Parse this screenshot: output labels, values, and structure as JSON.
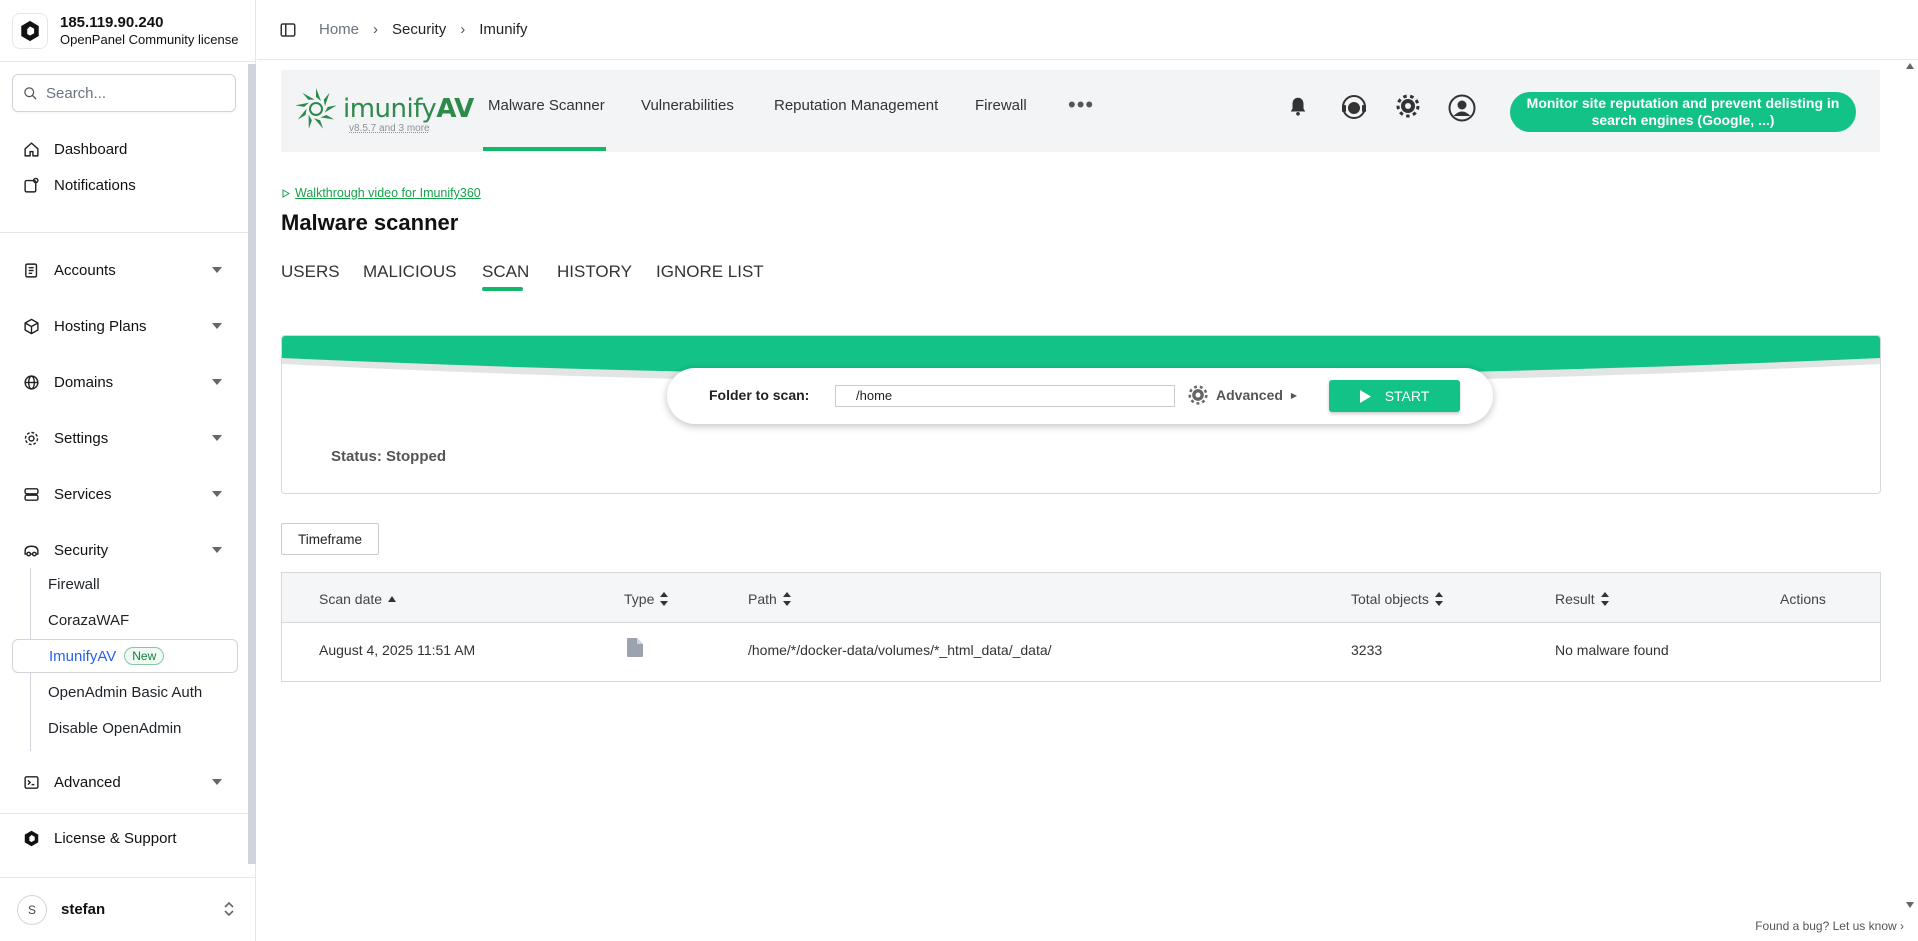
{
  "sidebar": {
    "host": "185.119.90.240",
    "license": "OpenPanel Community license",
    "search_placeholder": "Search...",
    "items": [
      {
        "label": "Dashboard",
        "icon": "home-icon"
      },
      {
        "label": "Notifications",
        "icon": "notification-icon"
      },
      {
        "label": "Accounts",
        "icon": "accounts-icon"
      },
      {
        "label": "Hosting Plans",
        "icon": "package-icon"
      },
      {
        "label": "Domains",
        "icon": "globe-icon"
      },
      {
        "label": "Settings",
        "icon": "gear-icon"
      },
      {
        "label": "Services",
        "icon": "server-icon"
      },
      {
        "label": "Security",
        "icon": "security-icon"
      },
      {
        "label": "Advanced",
        "icon": "terminal-icon"
      },
      {
        "label": "License & Support",
        "icon": "openpanel-logo-icon"
      }
    ],
    "security_sub": [
      {
        "label": "Firewall"
      },
      {
        "label": "CorazaWAF"
      },
      {
        "label": "ImunifyAV",
        "badge": "New"
      },
      {
        "label": "OpenAdmin Basic Auth"
      },
      {
        "label": "Disable OpenAdmin"
      }
    ],
    "user_initial": "S",
    "user_name": "stefan"
  },
  "breadcrumb": [
    "Home",
    "Security",
    "Imunify"
  ],
  "imunify": {
    "logo_light": "imunify",
    "logo_bold": "AV",
    "version": "v8.5.7 and 3 more",
    "tabs": [
      "Malware Scanner",
      "Vulnerabilities",
      "Reputation Management",
      "Firewall"
    ],
    "more": "•••",
    "cta": "Monitor site reputation and prevent delisting in search engines (Google, ...)"
  },
  "page": {
    "walkthrough": "Walkthrough video for Imunify360",
    "title": "Malware scanner",
    "tabs": [
      "USERS",
      "MALICIOUS",
      "SCAN",
      "HISTORY",
      "IGNORE LIST"
    ],
    "active_tab": "SCAN"
  },
  "scan": {
    "folder_label": "Folder to scan:",
    "folder_value": "/home",
    "advanced_label": "Advanced",
    "start_label": "START",
    "status": "Status: Stopped"
  },
  "timeframe_label": "Timeframe",
  "table": {
    "columns": [
      "Scan date",
      "Type",
      "Path",
      "Total objects",
      "Result",
      "Actions"
    ],
    "rows": [
      {
        "date": "August 4, 2025 11:51 AM",
        "type_icon": "file-icon",
        "path": "/home/*/docker-data/volumes/*_html_data/_data/",
        "total": "3233",
        "result": "No malware found"
      }
    ]
  },
  "found_bug": "Found a bug? Let us know",
  "colors": {
    "accent_green": "#12c286",
    "active_link": "#2563eb"
  }
}
